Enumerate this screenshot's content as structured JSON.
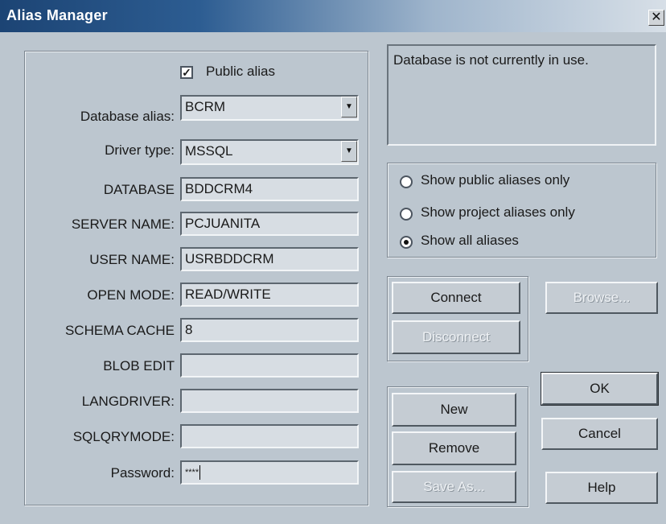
{
  "window": {
    "title": "Alias Manager",
    "close_glyph": "✕"
  },
  "form": {
    "public_alias": {
      "label": "Public alias",
      "checked": true
    },
    "database_alias": {
      "label": "Database alias:",
      "value": "BCRM"
    },
    "driver_type": {
      "label": "Driver type:",
      "value": "MSSQL"
    },
    "params": [
      {
        "label": "DATABASE",
        "value": "BDDCRM4"
      },
      {
        "label": "SERVER NAME:",
        "value": "PCJUANITA"
      },
      {
        "label": "USER NAME:",
        "value": "USRBDDCRM"
      },
      {
        "label": "OPEN MODE:",
        "value": "READ/WRITE"
      },
      {
        "label": "SCHEMA CACHE",
        "value": "8"
      },
      {
        "label": "BLOB EDIT",
        "value": ""
      },
      {
        "label": "LANGDRIVER:",
        "value": ""
      },
      {
        "label": "SQLQRYMODE:",
        "value": ""
      }
    ],
    "password": {
      "label": "Password:",
      "value": "****"
    }
  },
  "status": {
    "text": "Database is not currently in use."
  },
  "filter": {
    "options": [
      {
        "label": "Show public aliases only",
        "selected": false
      },
      {
        "label": "Show project aliases only",
        "selected": false
      },
      {
        "label": "Show all aliases",
        "selected": true
      }
    ]
  },
  "buttons": {
    "connect": "Connect",
    "disconnect": "Disconnect",
    "browse": "Browse...",
    "new": "New",
    "remove": "Remove",
    "save_as": "Save As...",
    "ok": "OK",
    "cancel": "Cancel",
    "help": "Help"
  }
}
